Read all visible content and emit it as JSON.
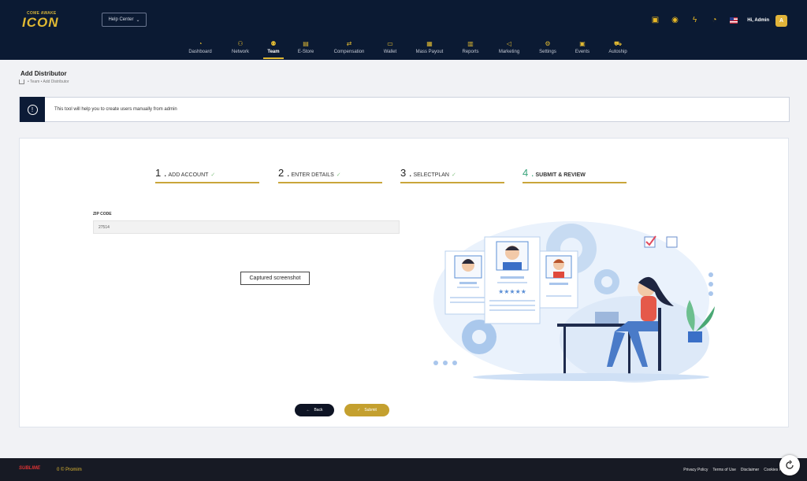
{
  "header": {
    "logo_small": "COME AWAKE",
    "logo_text": "ICON",
    "help_center": "Help Center",
    "greeting": "Hi, Admin",
    "avatar_letter": "A"
  },
  "nav": [
    {
      "label": "Dashboard"
    },
    {
      "label": "Network"
    },
    {
      "label": "Team"
    },
    {
      "label": "E-Store"
    },
    {
      "label": "Compensation"
    },
    {
      "label": "Wallet"
    },
    {
      "label": "Mass Payout"
    },
    {
      "label": "Reports"
    },
    {
      "label": "Marketing"
    },
    {
      "label": "Settings"
    },
    {
      "label": "Events"
    },
    {
      "label": "Autoship"
    }
  ],
  "page": {
    "title": "Add Distributor",
    "breadcrumb": "• Team • Add Distributor",
    "alert": "This tool will help you to create users manually from admin"
  },
  "steps": [
    {
      "num": "1 .",
      "label": "ADD ACCOUNT",
      "check": "✓"
    },
    {
      "num": "2 .",
      "label": "ENTER DETAILS",
      "check": "✓"
    },
    {
      "num": "3 .",
      "label": "SELECTPLAN",
      "check": "✓"
    },
    {
      "num": "4 .",
      "label": "SUBMIT & REVIEW",
      "check": ""
    }
  ],
  "form": {
    "zip_label": "ZIP CODE",
    "zip_value": "27514",
    "captured": "Captured screenshot"
  },
  "buttons": {
    "back": "Back",
    "submit": "Submit"
  },
  "footer": {
    "logo": "SUBLIME",
    "copyright": "0 © Promim",
    "links": [
      "Privacy Policy",
      "Terms of Use",
      "Disclaimer",
      "Cookies P"
    ]
  },
  "colors": {
    "navy": "#0b1a33",
    "gold": "#e0b933",
    "accent_green": "#3aa57c"
  }
}
